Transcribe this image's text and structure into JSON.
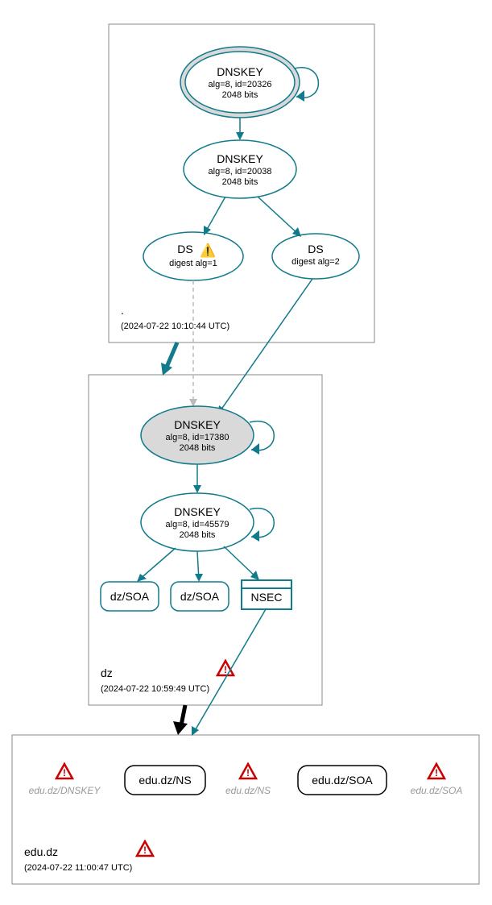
{
  "zones": {
    "root": {
      "label": ".",
      "timestamp": "(2024-07-22 10:10:44 UTC)"
    },
    "dz": {
      "label": "dz",
      "timestamp": "(2024-07-22 10:59:49 UTC)"
    },
    "edudz": {
      "label": "edu.dz",
      "timestamp": "(2024-07-22 11:00:47 UTC)"
    }
  },
  "nodes": {
    "root_ksk": {
      "title": "DNSKEY",
      "line2": "alg=8, id=20326",
      "line3": "2048 bits"
    },
    "root_zsk": {
      "title": "DNSKEY",
      "line2": "alg=8, id=20038",
      "line3": "2048 bits"
    },
    "ds1": {
      "title": "DS",
      "line2": "digest alg=1"
    },
    "ds2": {
      "title": "DS",
      "line2": "digest alg=2"
    },
    "dz_ksk": {
      "title": "DNSKEY",
      "line2": "alg=8, id=17380",
      "line3": "2048 bits"
    },
    "dz_zsk": {
      "title": "DNSKEY",
      "line2": "alg=8, id=45579",
      "line3": "2048 bits"
    },
    "dz_soa1": {
      "title": "dz/SOA"
    },
    "dz_soa2": {
      "title": "dz/SOA"
    },
    "dz_nsec": {
      "title": "NSEC"
    },
    "edudz_dnskey": {
      "title": "edu.dz/DNSKEY"
    },
    "edudz_ns_box": {
      "title": "edu.dz/NS"
    },
    "edudz_ns_err": {
      "title": "edu.dz/NS"
    },
    "edudz_soa_box": {
      "title": "edu.dz/SOA"
    },
    "edudz_soa_err": {
      "title": "edu.dz/SOA"
    }
  },
  "icons": {
    "warn_yellow": "⚠",
    "warn_red": "⚠"
  }
}
